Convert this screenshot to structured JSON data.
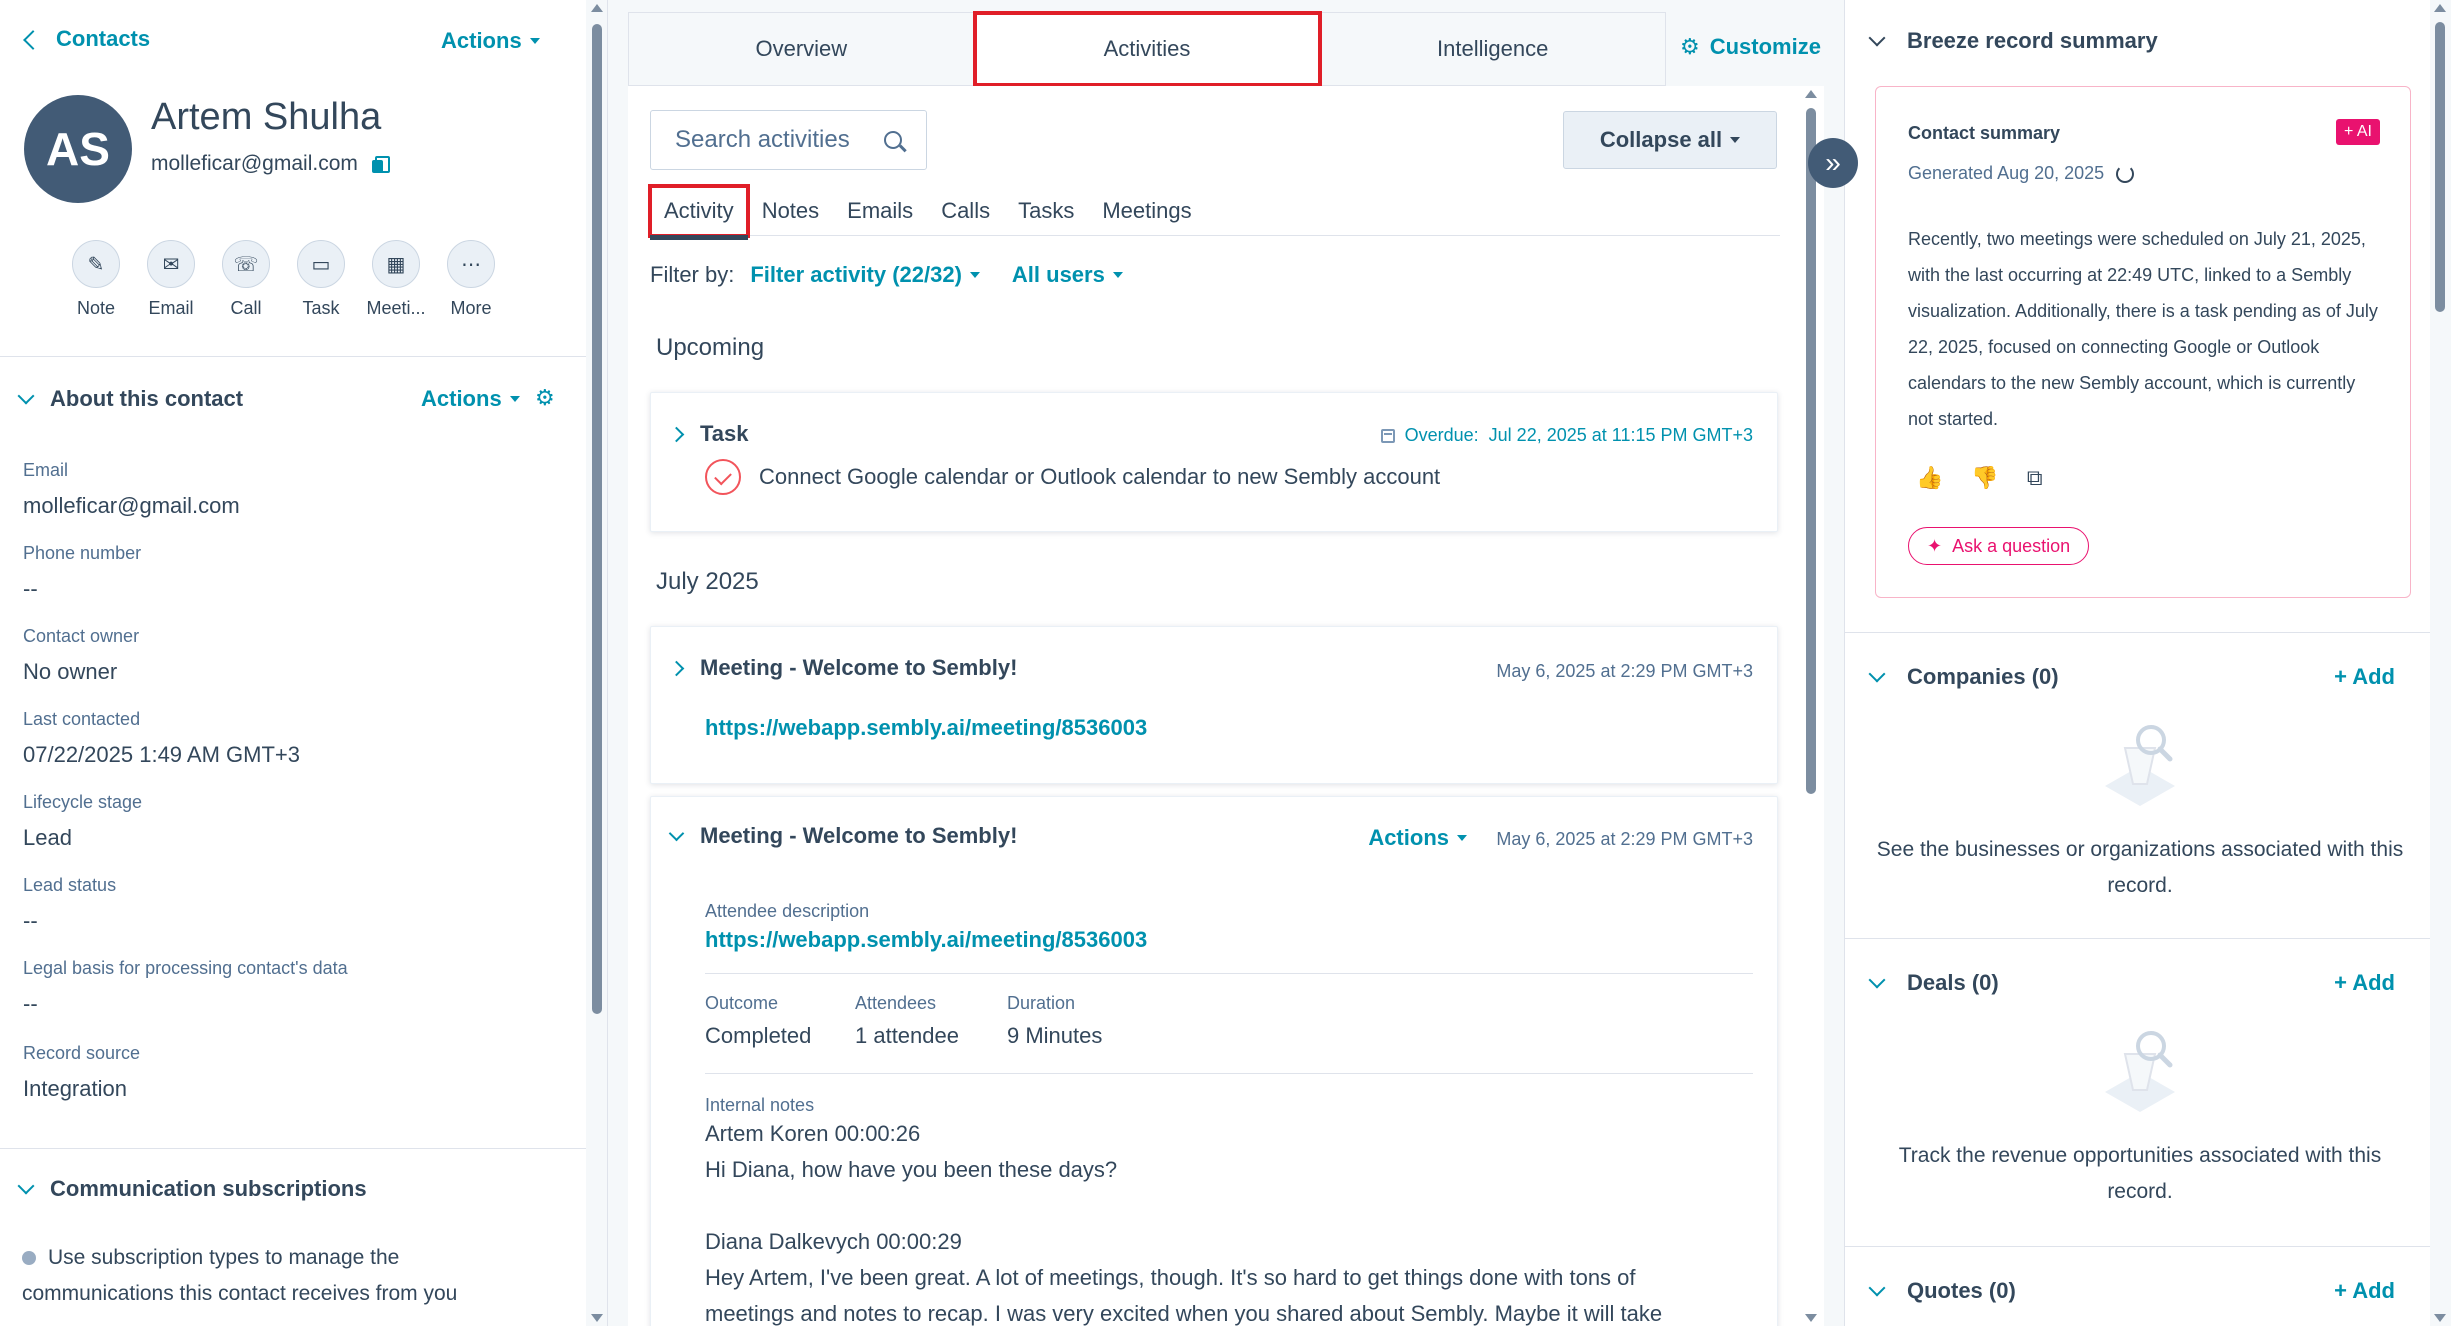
{
  "left": {
    "back_label": "Contacts",
    "actions_label": "Actions",
    "avatar_initials": "AS",
    "name": "Artem Shulha",
    "email": "molleficar@gmail.com",
    "quick_actions": [
      {
        "label": "Note",
        "icon": "note-icon",
        "glyph": "✎"
      },
      {
        "label": "Email",
        "icon": "email-icon",
        "glyph": "✉"
      },
      {
        "label": "Call",
        "icon": "phone-icon",
        "glyph": "☏"
      },
      {
        "label": "Task",
        "icon": "task-icon",
        "glyph": "▭"
      },
      {
        "label": "Meeti...",
        "icon": "calendar-icon",
        "glyph": "▦"
      },
      {
        "label": "More",
        "icon": "more-icon",
        "glyph": "⋯"
      }
    ],
    "about": {
      "title": "About this contact",
      "actions_label": "Actions",
      "properties": [
        {
          "label": "Email",
          "value": "molleficar@gmail.com"
        },
        {
          "label": "Phone number",
          "value": "--"
        },
        {
          "label": "Contact owner",
          "value": "No owner"
        },
        {
          "label": "Last contacted",
          "value": "07/22/2025 1:49 AM GMT+3"
        },
        {
          "label": "Lifecycle stage",
          "value": "Lead"
        },
        {
          "label": "Lead status",
          "value": "--"
        },
        {
          "label": "Legal basis for processing contact's data",
          "value": "--"
        },
        {
          "label": "Record source",
          "value": "Integration"
        }
      ]
    },
    "subscriptions": {
      "title": "Communication subscriptions",
      "text": "Use subscription types to manage the communications this contact receives from you"
    }
  },
  "middle": {
    "tabs": [
      "Overview",
      "Activities",
      "Intelligence"
    ],
    "active_tab": "Activities",
    "customize_label": "Customize",
    "search_placeholder": "Search activities",
    "collapse_label": "Collapse all",
    "subtabs": [
      "Activity",
      "Notes",
      "Emails",
      "Calls",
      "Tasks",
      "Meetings"
    ],
    "active_subtab": "Activity",
    "filter_by": "Filter by:",
    "filter_activity": "Filter activity (22/32)",
    "all_users": "All users",
    "upcoming_title": "Upcoming",
    "task_card": {
      "type": "Task",
      "overdue_label": "Overdue:",
      "overdue_date": "Jul 22, 2025 at 11:15 PM GMT+3",
      "text": "Connect Google calendar or Outlook calendar to new Sembly account"
    },
    "month_title": "July 2025",
    "meeting_collapsed": {
      "title": "Meeting - Welcome to Sembly!",
      "date": "May 6, 2025 at 2:29 PM GMT+3",
      "link": "https://webapp.sembly.ai/meeting/8536003"
    },
    "meeting_expanded": {
      "title": "Meeting - Welcome to Sembly!",
      "actions_label": "Actions",
      "date": "May 6, 2025 at 2:29 PM GMT+3",
      "attendee_desc_label": "Attendee description",
      "link": "https://webapp.sembly.ai/meeting/8536003",
      "outcome_label": "Outcome",
      "outcome_value": "Completed",
      "attendees_label": "Attendees",
      "attendees_value": "1 attendee",
      "duration_label": "Duration",
      "duration_value": "9 Minutes",
      "notes_label": "Internal notes",
      "note_lines": [
        "Artem Koren 00:00:26",
        "Hi Diana, how have you been these days?",
        "",
        "Diana Dalkevych 00:00:29",
        "Hey Artem, I've been great. A lot of meetings, though. It's so hard to get things done with tons of",
        "meetings and notes to recap. I was very excited when you shared about Sembly. Maybe it will take"
      ]
    }
  },
  "right": {
    "breeze_title": "Breeze record summary",
    "summary": {
      "title": "Contact summary",
      "badge": "+ AI",
      "generated": "Generated Aug 20, 2025",
      "body": "Recently, two meetings were scheduled on July 21, 2025, with the last occurring at 22:49 UTC, linked to a Sembly visualization. Additionally, there is a task pending as of July 22, 2025, focused on connecting Google or Outlook calendars to the new Sembly account, which is currently not started.",
      "ask_label": "Ask a question"
    },
    "companies": {
      "title": "Companies (0)",
      "add": "+ Add",
      "empty": "See the businesses or organizations associated with this record."
    },
    "deals": {
      "title": "Deals (0)",
      "add": "+ Add",
      "empty": "Track the revenue opportunities associated with this record."
    },
    "quotes": {
      "title": "Quotes (0)",
      "add": "+ Add"
    }
  }
}
